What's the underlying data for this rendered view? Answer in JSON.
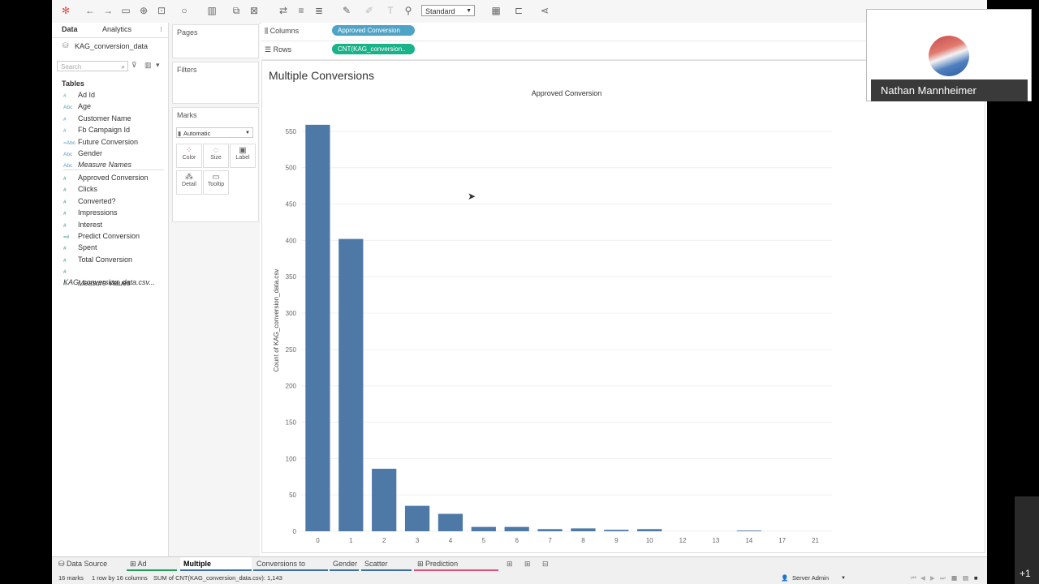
{
  "toolbar": {
    "icons": [
      "tableau-logo-icon",
      "back-icon",
      "forward-icon",
      "save-icon",
      "new-data-source-icon",
      "pause-updates-icon",
      "refresh-icon",
      "new-worksheet-icon",
      "duplicate-icon",
      "clear-icon",
      "swap-icon",
      "sort-asc-icon",
      "sort-desc-icon",
      "highlight-icon",
      "group-icon",
      "labels-icon",
      "pin-icon",
      "fit-dropdown",
      "show-cards-icon",
      "presentation-icon",
      "share-icon"
    ],
    "fit_value": "Standard"
  },
  "data_pane": {
    "tab_data": "Data",
    "tab_analytics": "Analytics",
    "datasource": "KAG_conversion_data",
    "search_placeholder": "Search",
    "tables_heading": "Tables",
    "dimensions": [
      {
        "type": "#",
        "name": "Ad Id"
      },
      {
        "type": "Abc",
        "name": "Age"
      },
      {
        "type": "#",
        "name": "Customer Name"
      },
      {
        "type": "#",
        "name": "Fb Campaign Id"
      },
      {
        "type": "=Abc",
        "name": "Future Conversion"
      },
      {
        "type": "Abc",
        "name": "Gender"
      },
      {
        "type": "Abc",
        "name": "Measure Names"
      }
    ],
    "measures": [
      {
        "type": "#",
        "name": "Approved Conversion"
      },
      {
        "type": "#",
        "name": "Clicks"
      },
      {
        "type": "#",
        "name": "Converted?"
      },
      {
        "type": "#",
        "name": "Impressions"
      },
      {
        "type": "#",
        "name": "Interest"
      },
      {
        "type": "=#",
        "name": "Predict Conversion"
      },
      {
        "type": "#",
        "name": "Spent"
      },
      {
        "type": "#",
        "name": "Total Conversion"
      },
      {
        "type": "#",
        "name": "KAG_conversion_data.csv..."
      },
      {
        "type": "#",
        "name": "Measure Values"
      }
    ]
  },
  "cards": {
    "pages": "Pages",
    "filters": "Filters",
    "marks": "Marks",
    "mark_type": "Automatic",
    "mark_buttons": [
      "Color",
      "Size",
      "Label",
      "Detail",
      "Tooltip"
    ]
  },
  "shelves": {
    "columns_label": "Columns",
    "columns_pill": "Approved Conversion",
    "rows_label": "Rows",
    "rows_pill": "CNT(KAG_conversion..",
    "colors": {
      "dimension_pill": "#4fa3c7",
      "measure_pill": "#19b38a"
    }
  },
  "view": {
    "title": "Multiple Conversions"
  },
  "chart_data": {
    "type": "bar",
    "title": "Approved Conversion",
    "xlabel": "",
    "ylabel": "Count of KAG_conversion_data.csv",
    "categories": [
      "0",
      "1",
      "2",
      "3",
      "4",
      "5",
      "6",
      "7",
      "8",
      "9",
      "10",
      "12",
      "13",
      "14",
      "17",
      "21"
    ],
    "values": [
      559,
      402,
      86,
      35,
      24,
      6,
      6,
      3,
      4,
      2,
      3,
      0,
      0,
      1,
      0,
      0
    ],
    "ylim": [
      0,
      580
    ],
    "yticks": [
      0,
      50,
      100,
      150,
      200,
      250,
      300,
      350,
      400,
      450,
      500,
      550
    ],
    "bar_color": "#4e79a7",
    "grid": true
  },
  "sheet_tabs": {
    "data_source": "Data Source",
    "tabs": [
      {
        "label": "Ad Tracking",
        "color": "#1f9e5a",
        "active": false
      },
      {
        "label": "Multiple Conversions",
        "color": "#3b6fa8",
        "active": true
      },
      {
        "label": "Conversions to Spend",
        "color": "#3b6fa8",
        "active": false
      },
      {
        "label": "Gender",
        "color": "#3b6fa8",
        "active": false
      },
      {
        "label": "Scatter Matrix",
        "color": "#3b6fa8",
        "active": false
      },
      {
        "label": "Prediction Dashboard",
        "color": "#e0507a",
        "active": false
      }
    ]
  },
  "status_bar": {
    "marks": "16 marks",
    "rows_cols": "1 row by 16 columns",
    "sum": "SUM of CNT(KAG_conversion_data.csv): 1,143",
    "user": "Server Admin"
  },
  "webcam": {
    "name": "Nathan Mannheimer",
    "badge": "+1"
  }
}
